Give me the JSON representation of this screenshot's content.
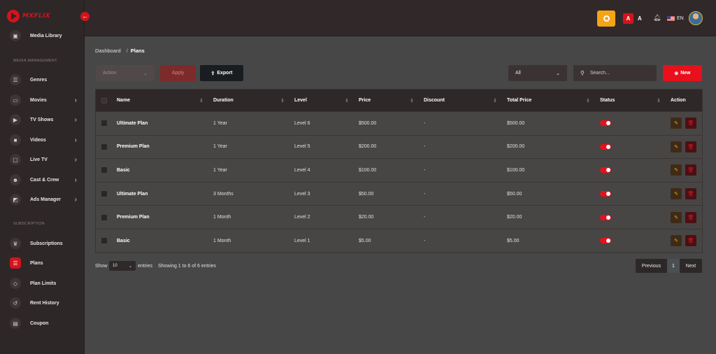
{
  "brand": {
    "name": "MXFLIX"
  },
  "sidebar": {
    "top_item": {
      "label": "Media Library",
      "icon": "media-library-icon"
    },
    "sections": [
      {
        "title": "MEDIA MANAGEMENT"
      },
      {
        "title": "SUBSCRIPTION"
      }
    ],
    "items": [
      {
        "label": "Genres",
        "icon": "genres-icon"
      },
      {
        "label": "Movies",
        "icon": "movies-icon",
        "has_children": true
      },
      {
        "label": "TV Shows",
        "icon": "tv-shows-icon",
        "has_children": true
      },
      {
        "label": "Videos",
        "icon": "videos-icon",
        "has_children": true
      },
      {
        "label": "Live TV",
        "icon": "live-tv-icon",
        "has_children": true
      },
      {
        "label": "Cast & Crew",
        "icon": "cast-crew-icon",
        "has_children": true
      },
      {
        "label": "Ads Manager",
        "icon": "ads-manager-icon",
        "has_children": true
      },
      {
        "label": "Subscriptions",
        "icon": "crown-icon"
      },
      {
        "label": "Plans",
        "icon": "list-icon",
        "active": true
      },
      {
        "label": "Plan Limits",
        "icon": "tag-icon"
      },
      {
        "label": "Rent History",
        "icon": "history-icon"
      },
      {
        "label": "Coupon",
        "icon": "coupon-icon"
      }
    ]
  },
  "header": {
    "font_large": "A",
    "font_small": "A",
    "language": "EN",
    "accent_color": "#e7101c",
    "settings_color": "#f5a416"
  },
  "breadcrumb": {
    "home": "Dashboard",
    "separator": "/",
    "current": "Plans"
  },
  "toolbar": {
    "action_placeholder": "Action",
    "apply_label": "Apply",
    "export_label": "Export",
    "filter_value": "All",
    "search_placeholder": "Search...",
    "new_label": "New"
  },
  "table": {
    "columns": [
      "Name",
      "Duration",
      "Level",
      "Price",
      "Discount",
      "Total Price",
      "Status",
      "Action"
    ],
    "rows": [
      {
        "name": "Ultimate Plan",
        "duration": "1 Year",
        "level": "Level 6",
        "price": "$500.00",
        "discount": "-",
        "total": "$500.00",
        "status": true
      },
      {
        "name": "Premium Plan",
        "duration": "1 Year",
        "level": "Level 5",
        "price": "$200.00",
        "discount": "-",
        "total": "$200.00",
        "status": true
      },
      {
        "name": "Basic",
        "duration": "1 Year",
        "level": "Level 4",
        "price": "$100.00",
        "discount": "-",
        "total": "$100.00",
        "status": true
      },
      {
        "name": "Ultimate Plan",
        "duration": "3 Months",
        "level": "Level 3",
        "price": "$50.00",
        "discount": "-",
        "total": "$50.00",
        "status": true
      },
      {
        "name": "Premium Plan",
        "duration": "1 Month",
        "level": "Level 2",
        "price": "$20.00",
        "discount": "-",
        "total": "$20.00",
        "status": true
      },
      {
        "name": "Basic",
        "duration": "1 Month",
        "level": "Level 1",
        "price": "$5.00",
        "discount": "-",
        "total": "$5.00",
        "status": true
      }
    ]
  },
  "footer": {
    "show_label": "Show",
    "page_length": "10",
    "entries_label": "entries",
    "info": "Showing 1 to 6 of 6 entries",
    "prev_label": "Previous",
    "current_page": "1",
    "next_label": "Next"
  }
}
